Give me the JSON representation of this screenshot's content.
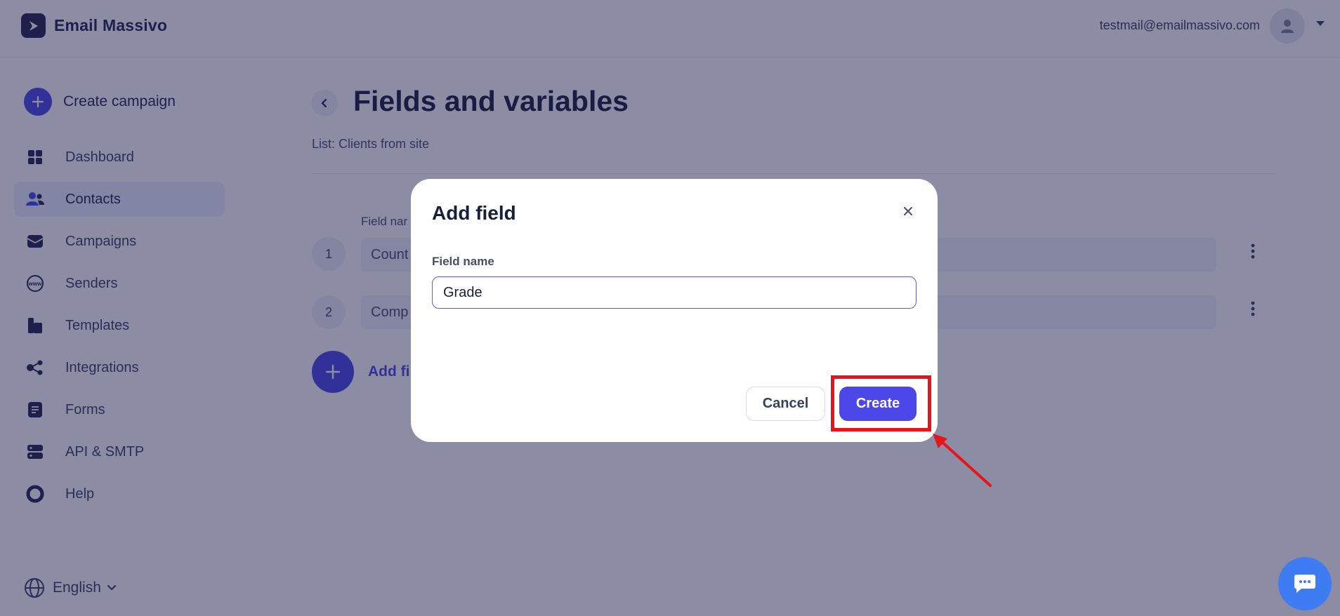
{
  "header": {
    "brand_name": "Email Massivo",
    "user_email": "testmail@emailmassivo.com"
  },
  "sidebar": {
    "create_campaign_label": "Create campaign",
    "items": [
      {
        "label": "Dashboard",
        "icon": "dashboard-icon",
        "active": false
      },
      {
        "label": "Contacts",
        "icon": "contacts-icon",
        "active": true
      },
      {
        "label": "Campaigns",
        "icon": "campaigns-icon",
        "active": false
      },
      {
        "label": "Senders",
        "icon": "senders-icon",
        "active": false
      },
      {
        "label": "Templates",
        "icon": "templates-icon",
        "active": false
      },
      {
        "label": "Integrations",
        "icon": "integrations-icon",
        "active": false
      },
      {
        "label": "Forms",
        "icon": "forms-icon",
        "active": false
      },
      {
        "label": "API & SMTP",
        "icon": "api-icon",
        "active": false
      },
      {
        "label": "Help",
        "icon": "help-icon",
        "active": false
      }
    ],
    "language": "English"
  },
  "main": {
    "title": "Fields and variables",
    "list_label": "List: Clients from site",
    "column_header": "Field nar",
    "rows": [
      {
        "number": "1",
        "field": "Count"
      },
      {
        "number": "2",
        "field": "Comp"
      }
    ],
    "add_field_label": "Add fi"
  },
  "modal": {
    "title": "Add field",
    "field_label": "Field name",
    "field_value": "Grade",
    "cancel_label": "Cancel",
    "create_label": "Create"
  },
  "colors": {
    "accent": "#4b47e8",
    "annotation": "#e8131b",
    "chat": "#3d7cf2",
    "dark": "#23244a"
  }
}
